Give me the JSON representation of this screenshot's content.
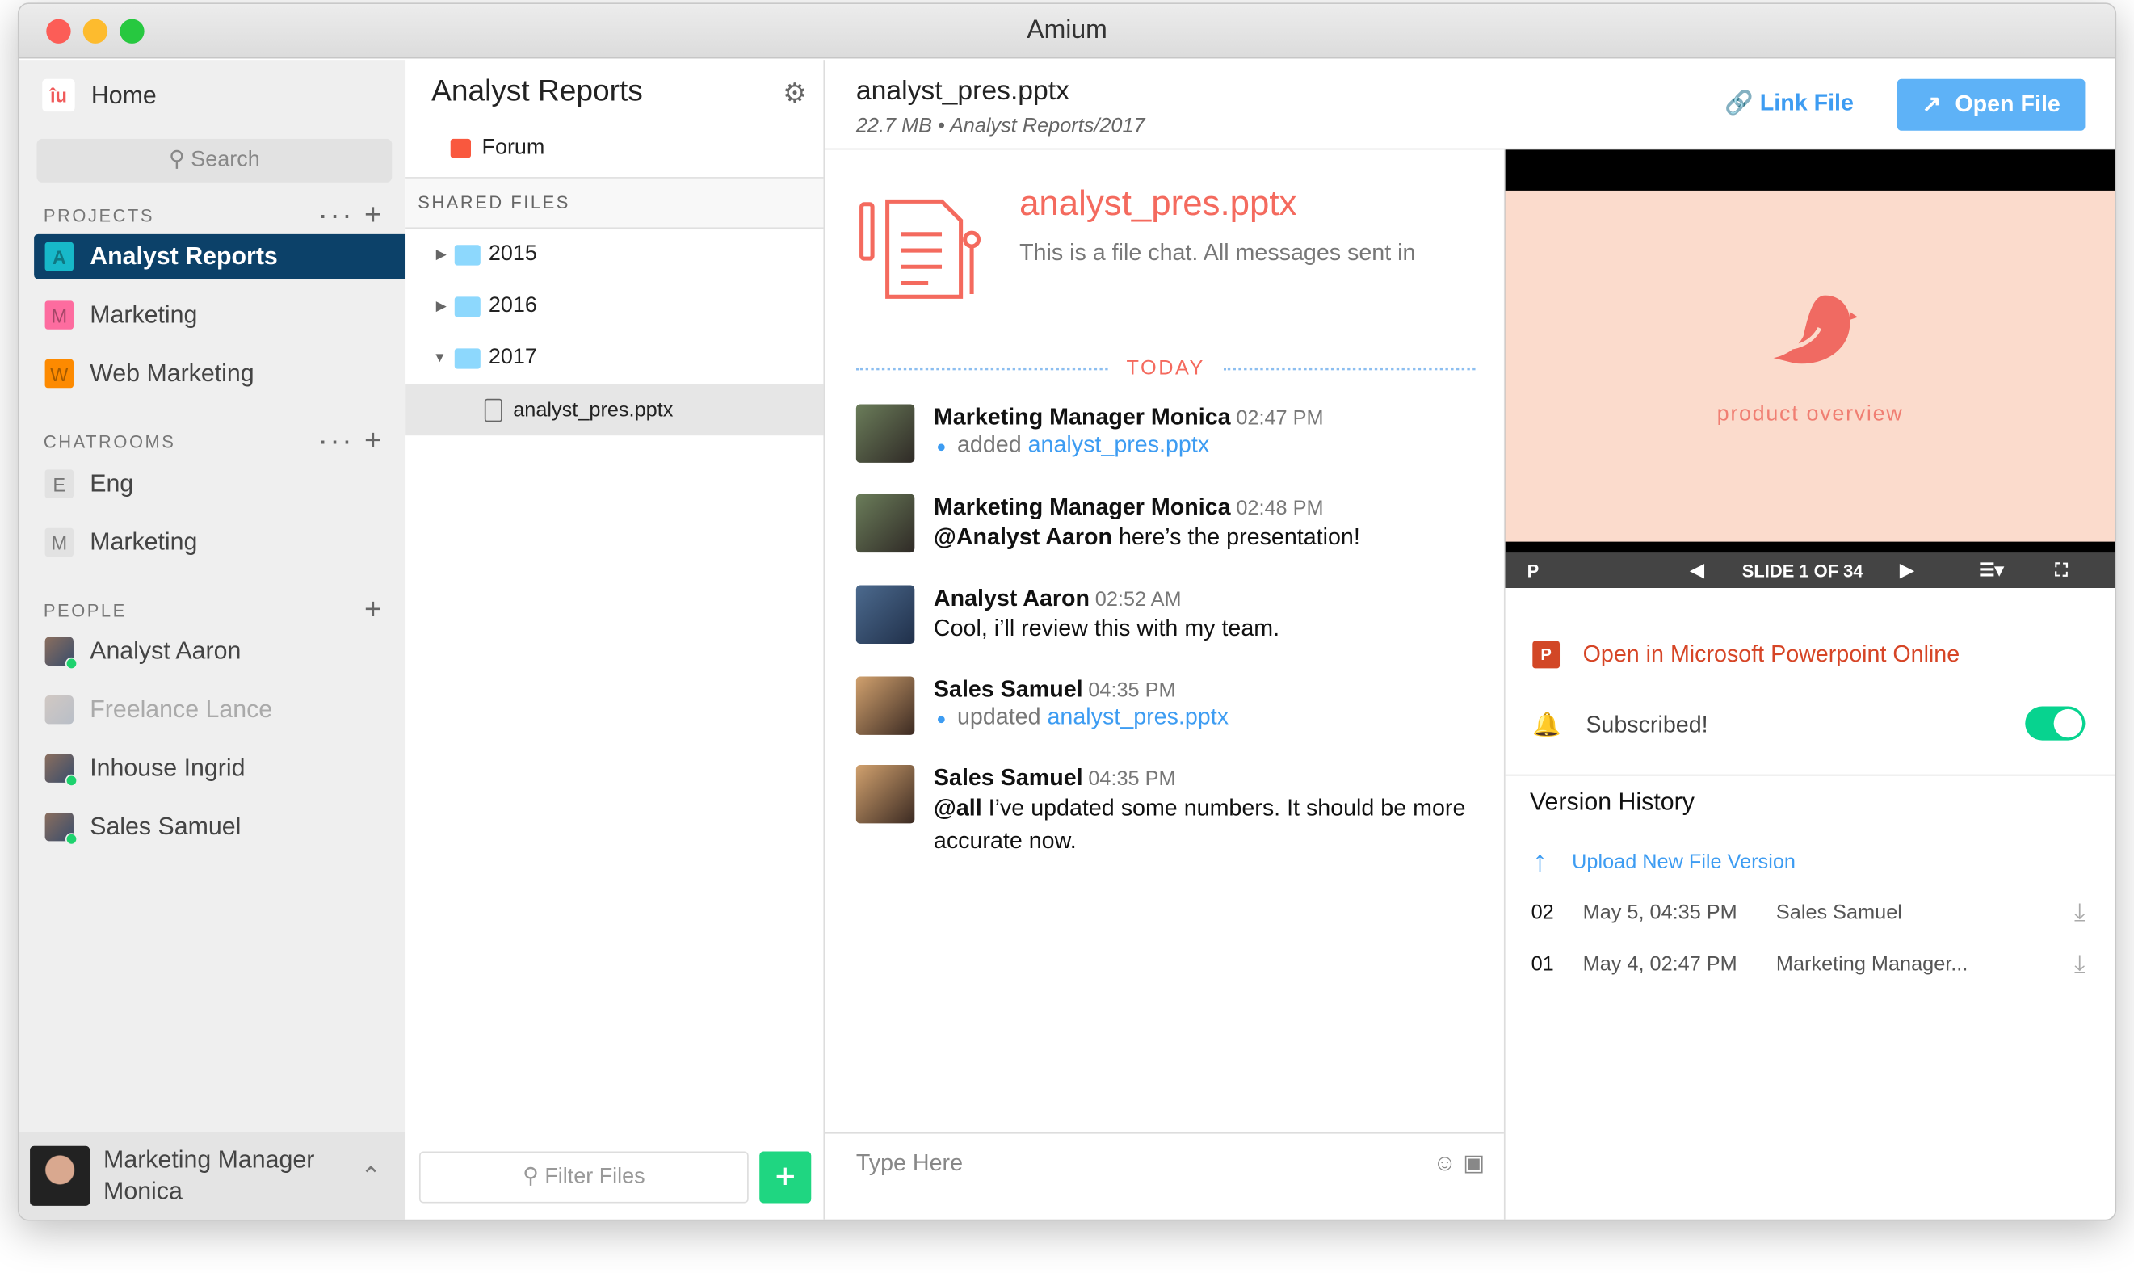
{
  "window": {
    "title": "Amium"
  },
  "sidebar": {
    "home": "Home",
    "search_placeholder": "Search",
    "projects_label": "PROJECTS",
    "projects": [
      {
        "letter": "A",
        "label": "Analyst Reports",
        "color": "#17b8c9"
      },
      {
        "letter": "M",
        "label": "Marketing",
        "color": "#fd6c9f"
      },
      {
        "letter": "W",
        "label": "Web Marketing",
        "color": "#fd8a00"
      }
    ],
    "chatrooms_label": "CHATROOMS",
    "chatrooms": [
      {
        "letter": "E",
        "label": "Eng"
      },
      {
        "letter": "M",
        "label": "Marketing"
      }
    ],
    "people_label": "PEOPLE",
    "people": [
      {
        "label": "Analyst Aaron",
        "online": true
      },
      {
        "label": "Freelance Lance",
        "online": false
      },
      {
        "label": "Inhouse Ingrid",
        "online": true
      },
      {
        "label": "Sales Samuel",
        "online": true
      }
    ],
    "current_user": {
      "line1": "Marketing Manager",
      "line2": "Monica"
    }
  },
  "files": {
    "title": "Analyst Reports",
    "forum": "Forum",
    "shared_label": "SHARED FILES",
    "folders": [
      "2015",
      "2016",
      "2017"
    ],
    "selected_file": "analyst_pres.pptx",
    "filter_placeholder": "Filter Files"
  },
  "header": {
    "file_name": "analyst_pres.pptx",
    "meta": "22.7 MB • Analyst Reports/2017",
    "link_file": "Link File",
    "open_file": "Open File"
  },
  "chat": {
    "intro_title": "analyst_pres.pptx",
    "intro_sub": "This is a file chat. All messages sent in",
    "divider": "TODAY",
    "messages": [
      {
        "author": "Marketing Manager Monica",
        "time": "02:47 PM",
        "action": "added",
        "file": "analyst_pres.pptx"
      },
      {
        "author": "Marketing Manager Monica",
        "time": "02:48 PM",
        "mention": "@Analyst Aaron",
        "text": " here’s the presentation!"
      },
      {
        "author": "Analyst Aaron",
        "time": "02:52 AM",
        "text": "Cool, i’ll review this with my team."
      },
      {
        "author": "Sales Samuel",
        "time": "04:35 PM",
        "action": "updated",
        "file": "analyst_pres.pptx"
      },
      {
        "author": "Sales Samuel",
        "time": "04:35 PM",
        "mention": "@all",
        "text": " I’ve updated some numbers. It should be more accurate now."
      }
    ],
    "input_placeholder": "Type Here"
  },
  "preview": {
    "slide_text": "product overview",
    "slide_counter": "SLIDE 1 OF 34",
    "current_slide": 1,
    "total_slides": 34
  },
  "details": {
    "open_ppt": "Open in Microsoft Powerpoint Online",
    "subscribed": "Subscribed!",
    "subscribed_on": true,
    "version_title": "Version History",
    "upload": "Upload New File Version",
    "versions": [
      {
        "num": "02",
        "date": "May 5, 04:35 PM",
        "by": "Sales Samuel"
      },
      {
        "num": "01",
        "date": "May 4, 02:47 PM",
        "by": "Marketing Manager..."
      }
    ]
  },
  "colors": {
    "accent": "#3d9cf2",
    "active_project": "#0c4169",
    "online": "#1ed26e",
    "brand": "#f46a5e"
  }
}
